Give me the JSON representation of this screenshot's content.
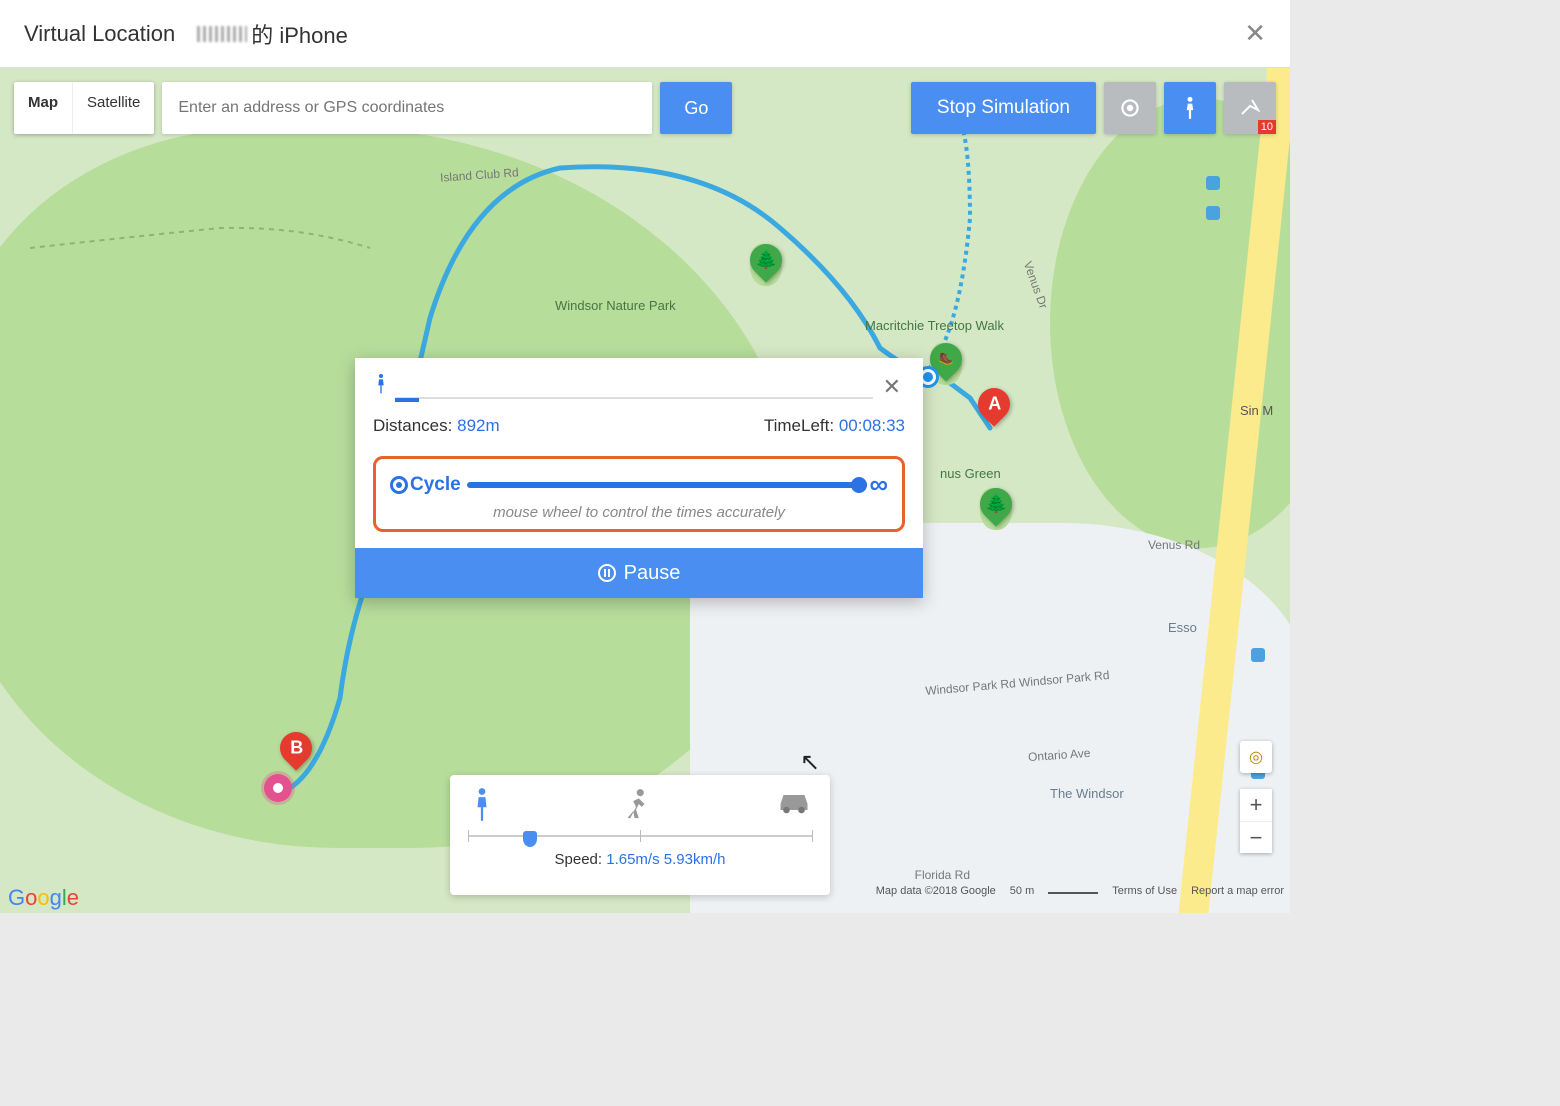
{
  "titlebar": {
    "title": "Virtual Location",
    "device_suffix": "的 iPhone"
  },
  "maptype": {
    "map": "Map",
    "satellite": "Satellite"
  },
  "search": {
    "placeholder": "Enter an address or GPS coordinates"
  },
  "buttons": {
    "go": "Go",
    "stop_sim": "Stop Simulation",
    "badge": "10"
  },
  "popup": {
    "distances_label": "Distances:",
    "distances_value": "892m",
    "timeleft_label": "TimeLeft:",
    "timeleft_value": "00:08:33",
    "cycle_label": "Cycle",
    "cycle_hint": "mouse wheel to control the times accurately",
    "pause": "Pause"
  },
  "speed": {
    "prefix": "Speed:",
    "value": "1.65m/s 5.93km/h"
  },
  "poi": {
    "windsor_park": "Windsor Nature Park",
    "treetop": "Macritchie Treetop Walk",
    "venus_green": "nus Green",
    "sin_m": "Sin M",
    "windsor": "The Windsor",
    "esso": "Esso",
    "island_club": "Island Club Rd",
    "venus_dr": "Venus Dr",
    "venus_rd": "Venus Rd",
    "windsor_park_rd": "Windsor Park Rd   Windsor Park Rd",
    "ontario": "Ontario Ave",
    "florida": "Florida Rd"
  },
  "markers": {
    "a": "A",
    "b": "B"
  },
  "footer": {
    "map_data": "Map data ©2018 Google",
    "scale": "50 m",
    "terms": "Terms of Use",
    "report": "Report a map error"
  }
}
